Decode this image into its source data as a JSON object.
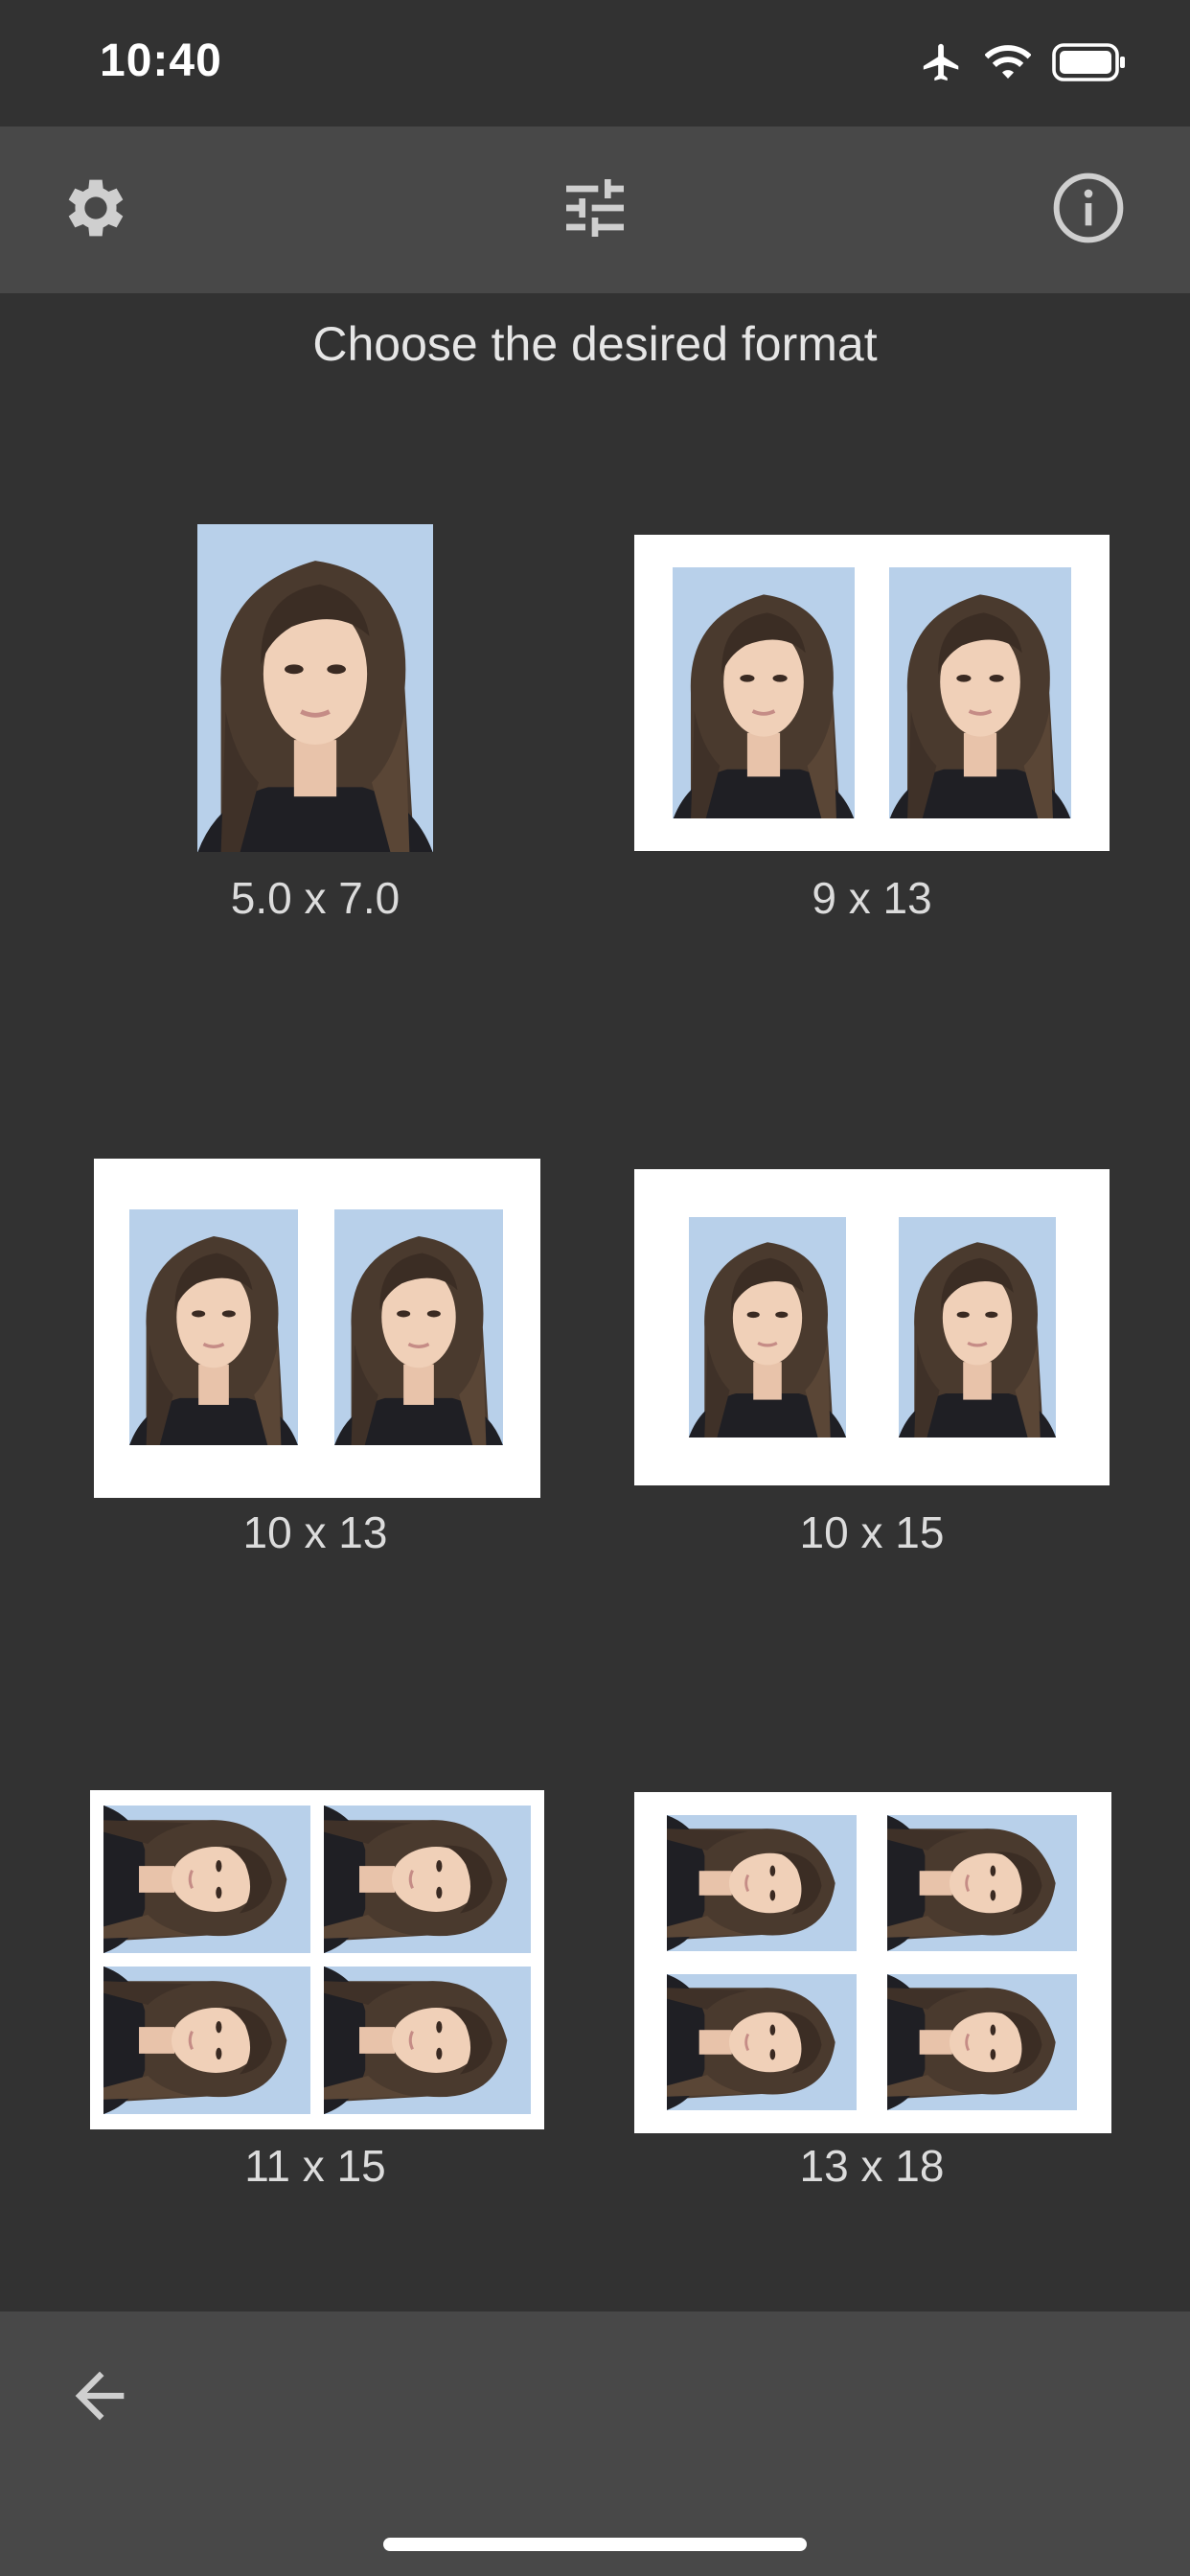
{
  "status_bar": {
    "time": "10:40",
    "icons": [
      "airplane-icon",
      "wifi-icon",
      "battery-icon"
    ]
  },
  "toolbar": {
    "left_icon": "gear-icon",
    "center_icon": "sliders-icon",
    "right_icon": "info-icon"
  },
  "title": "Choose the desired format",
  "formats": [
    {
      "label": "5.0 x 7.0",
      "layout": "single"
    },
    {
      "label": "9 x 13",
      "layout": "two-up"
    },
    {
      "label": "10 x 13",
      "layout": "two-up"
    },
    {
      "label": "10 x 15",
      "layout": "two-up"
    },
    {
      "label": "11 x 15",
      "layout": "four-up-rotated"
    },
    {
      "label": "13 x 18",
      "layout": "four-up-rotated"
    }
  ],
  "bottom_bar": {
    "back_icon": "arrow-left-icon"
  },
  "colors": {
    "background": "#323232",
    "bar": "#484848",
    "text": "#e6e6e6",
    "photo_background": "#b5cfe8"
  }
}
